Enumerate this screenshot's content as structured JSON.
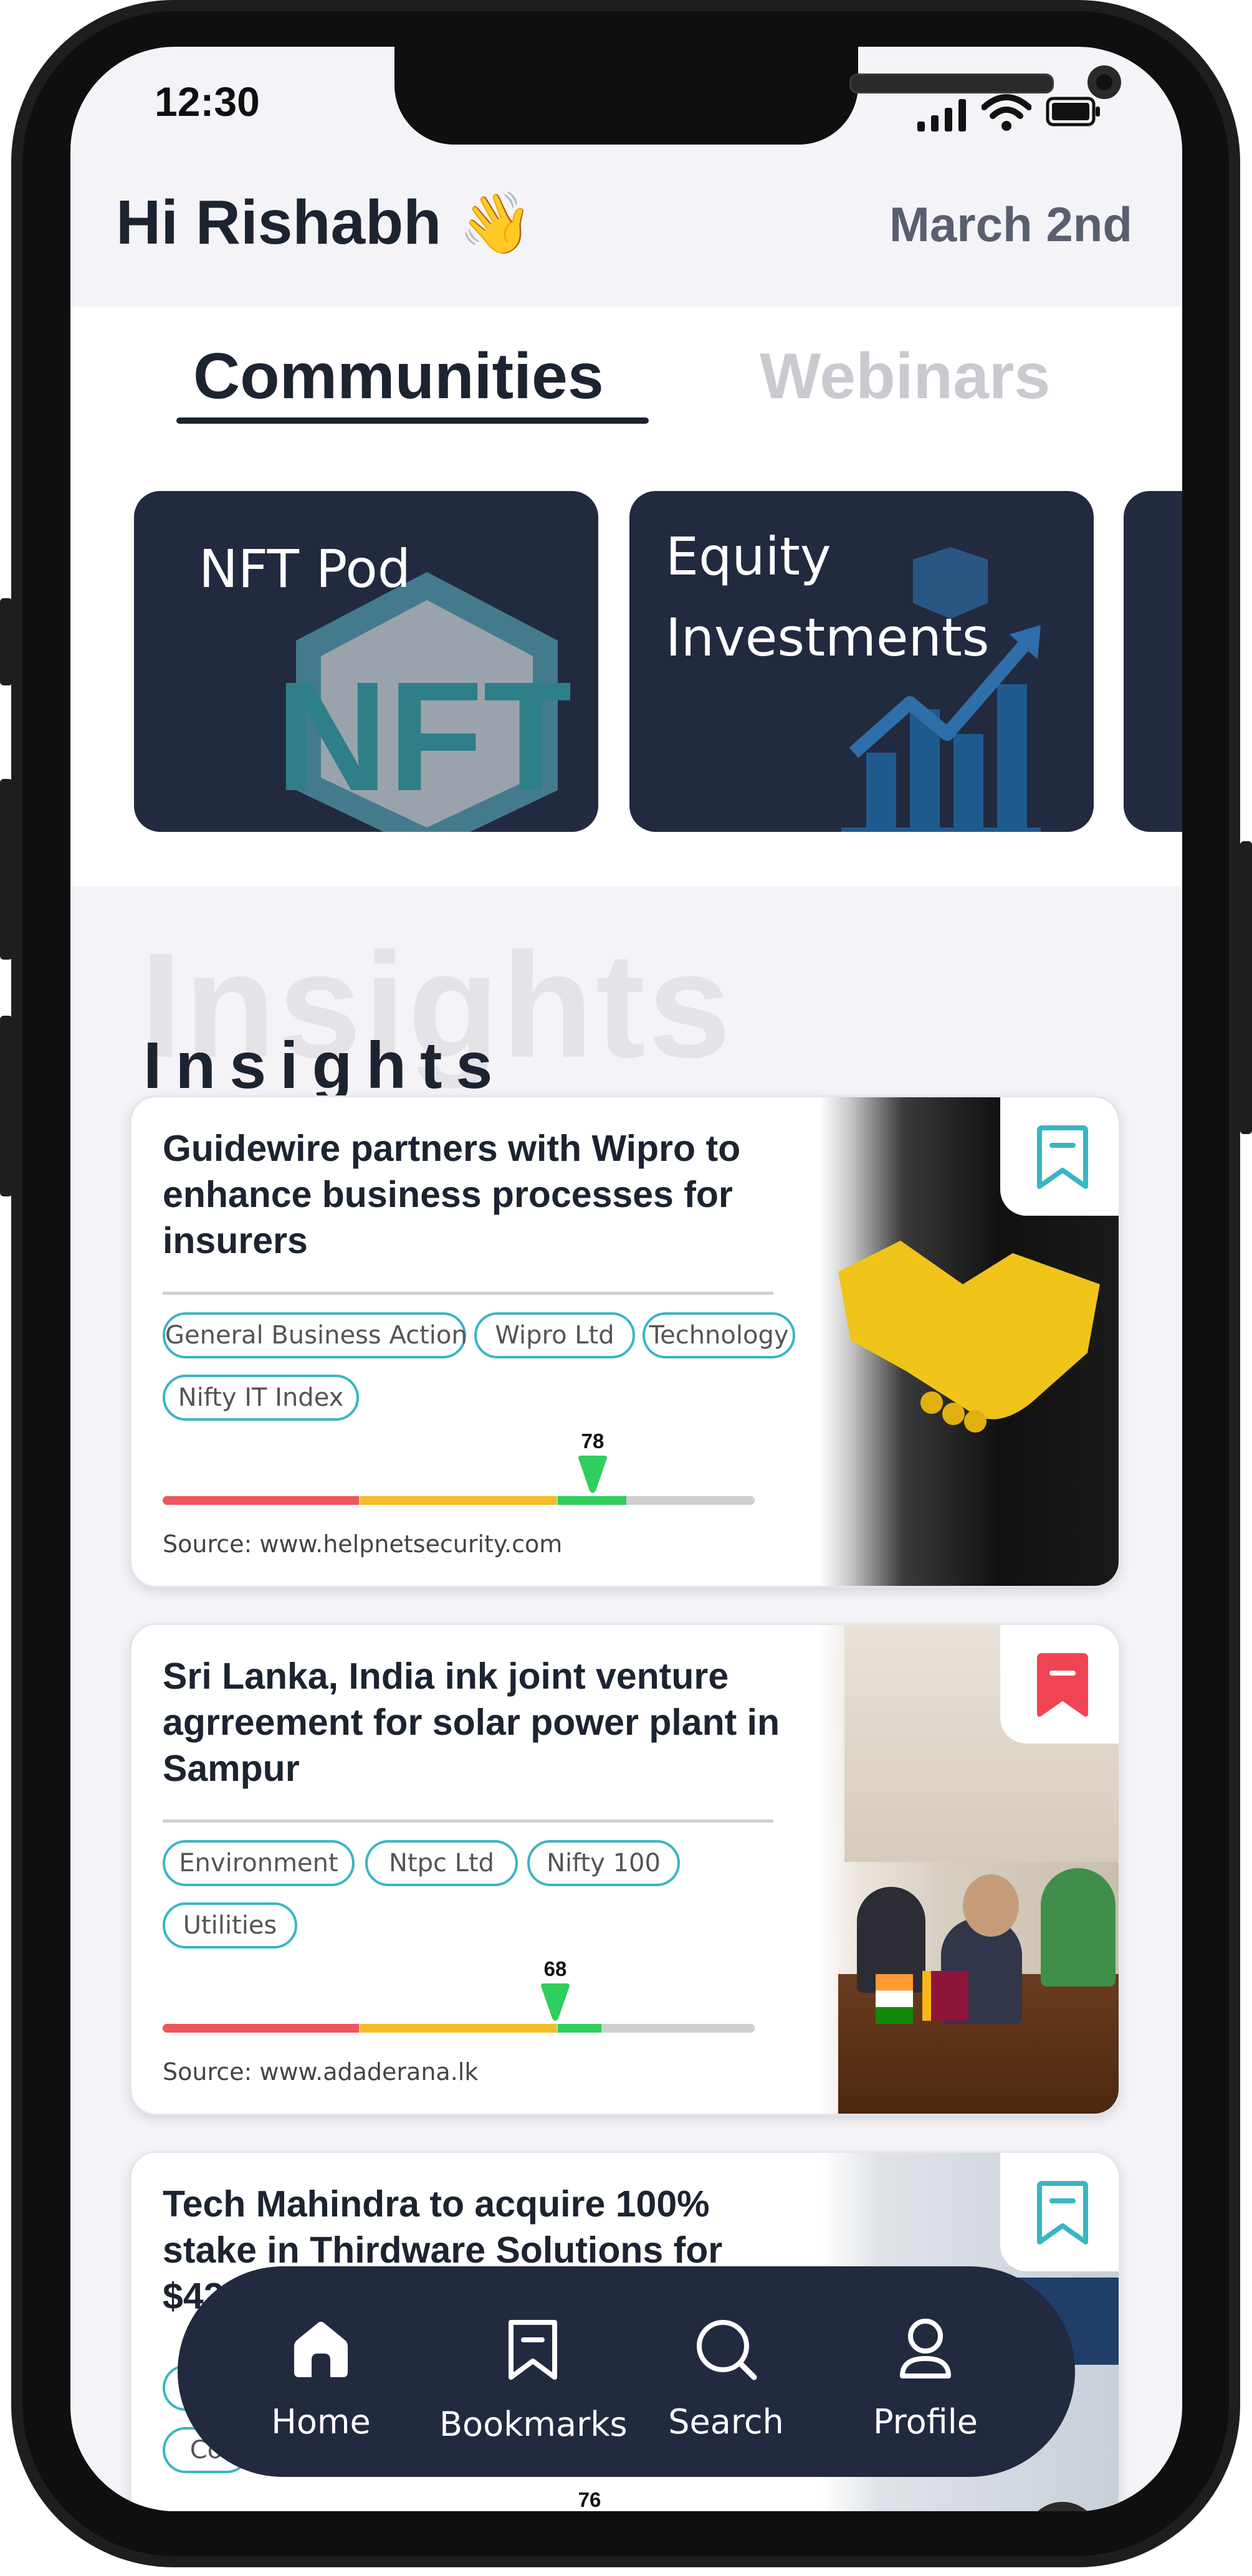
{
  "status_bar": {
    "time": "12:30"
  },
  "header": {
    "greeting": "Hi Rishabh",
    "greeting_emoji": "👋",
    "date": "March 2nd"
  },
  "tabs": [
    {
      "label": "Communities",
      "active": true
    },
    {
      "label": "Webinars",
      "active": false
    }
  ],
  "communities": [
    {
      "title_line1": "NFT Pod",
      "title_line2": "",
      "icon": "nft-hexagon-icon"
    },
    {
      "title_line1": "Equity",
      "title_line2": "Investments",
      "icon": "growth-chart-icon"
    }
  ],
  "insights": {
    "heading": "Insights",
    "heading_shadow": "Insights",
    "cards": [
      {
        "title": "Guidewire partners with Wipro to enhance business processes for insurers",
        "tags": [
          "General Business Action",
          "Wipro Ltd",
          "Technology",
          "Nifty IT Index"
        ],
        "score": 78,
        "source": "Source: www.helpnetsecurity.com",
        "bookmarked": false,
        "image": "handshake-photo"
      },
      {
        "title": "Sri Lanka, India ink joint venture agrreement for solar power plant in Sampur",
        "tags": [
          "Environment",
          "Ntpc Ltd",
          "Nifty 100",
          "Utilities"
        ],
        "score": 68,
        "source": "Source: www.adaderana.lk",
        "bookmarked": true,
        "image": "meeting-photo"
      },
      {
        "title": "Tech Mahindra to acquire 100% stake in Thirdware Solutions for $42",
        "tags": [
          "",
          "Co"
        ],
        "score": 76,
        "source": "",
        "bookmarked": false,
        "image": "event-photo"
      }
    ]
  },
  "bottom_nav": [
    {
      "label": "Home",
      "icon": "home-icon",
      "active": true
    },
    {
      "label": "Bookmarks",
      "icon": "bookmark-icon",
      "active": false
    },
    {
      "label": "Search",
      "icon": "search-icon",
      "active": false
    },
    {
      "label": "Profile",
      "icon": "profile-icon",
      "active": false
    }
  ],
  "colors": {
    "navy": "#222a40",
    "teal": "#3ab5c3",
    "bookmark_red": "#f04455",
    "meter_red": "#f2545b",
    "meter_yellow": "#f6bc26",
    "meter_green": "#2ecf5c"
  }
}
